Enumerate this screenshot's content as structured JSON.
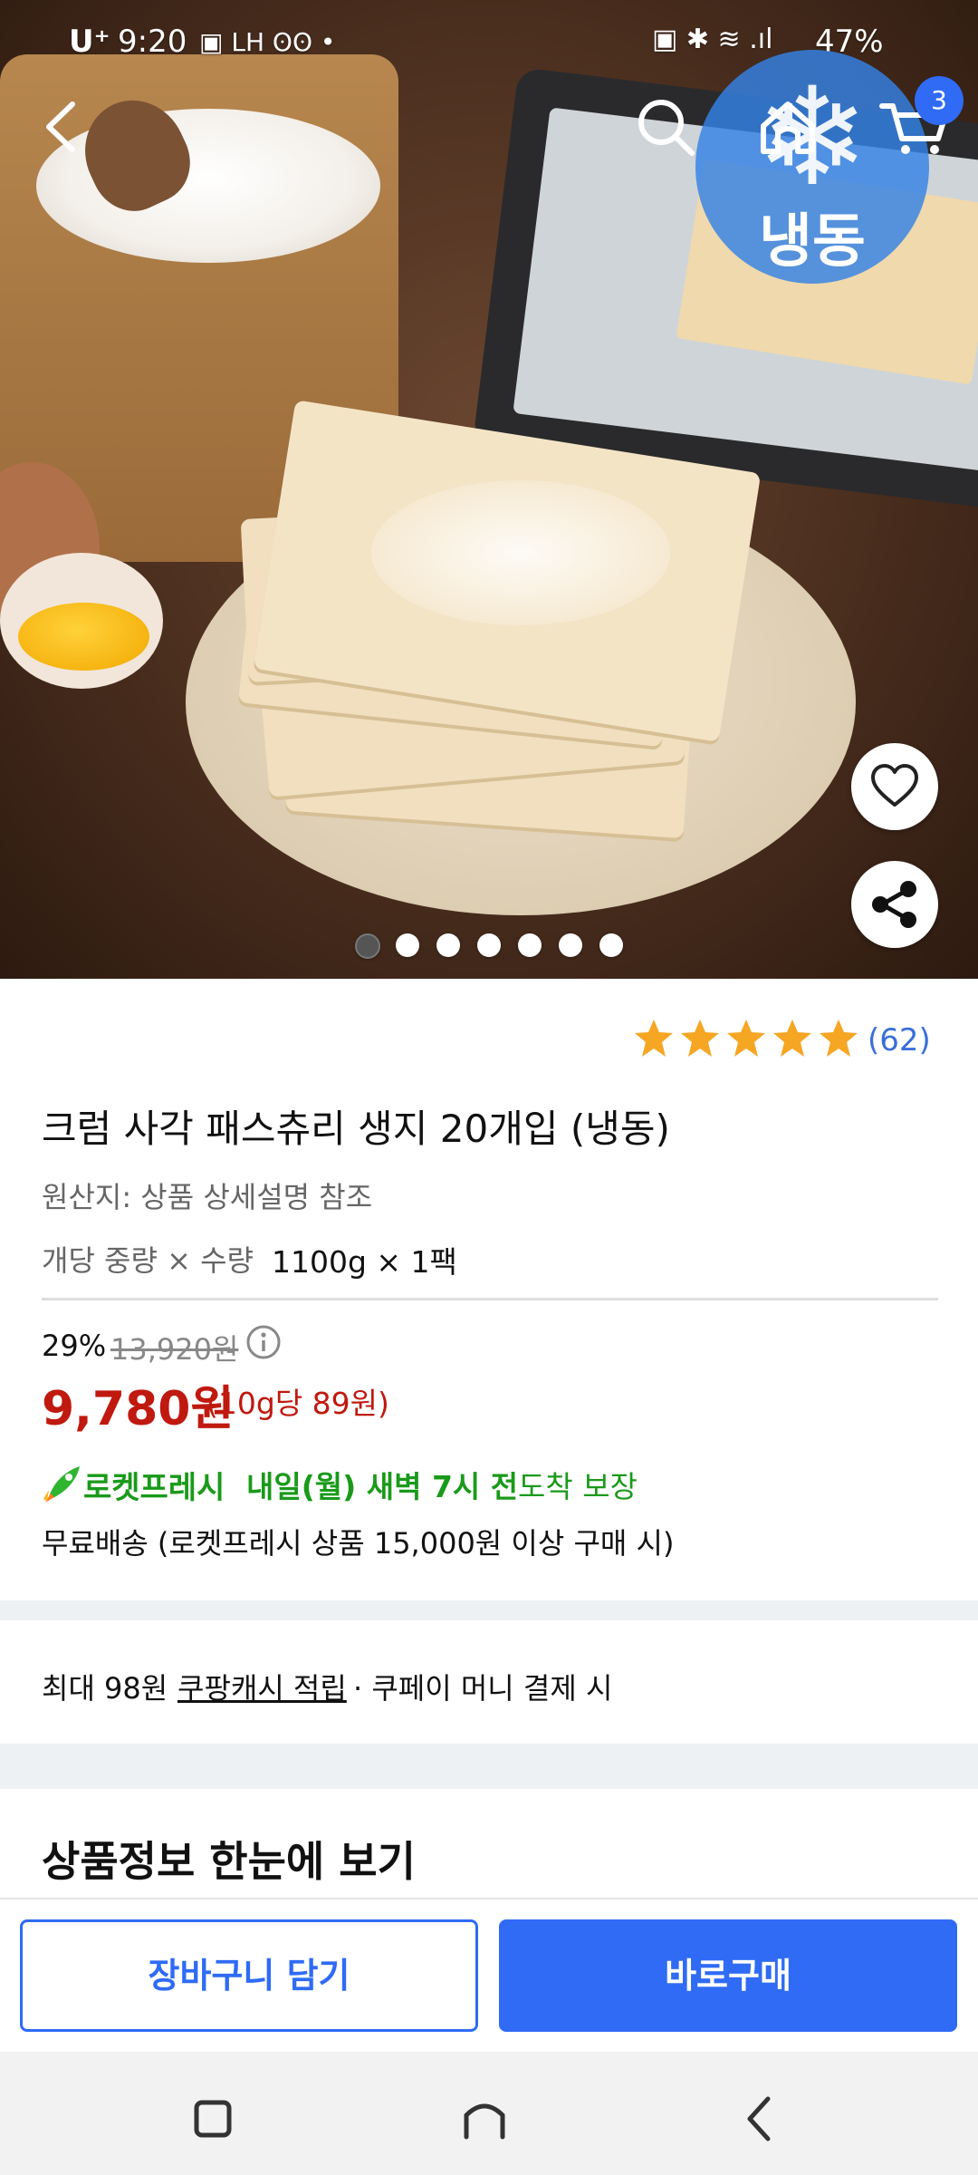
{
  "status_bar": {
    "carrier": "U⁺",
    "time": "9:20",
    "notification_icons": "▣ LH ʘʘ •",
    "system_icons": "▣ ✱ ≋ .ıl",
    "battery": "47%"
  },
  "nav": {
    "cart_count": "3",
    "frozen_label": "냉동",
    "frozen_icon": "snowflake-icon"
  },
  "gallery": {
    "image_count": 7,
    "active_index": 0
  },
  "product": {
    "rating": 5,
    "review_count": "(62)",
    "title": "크럼 사각 패스츄리 생지 20개입 (냉동)",
    "origin": "원산지: 상품 상세설명 참조",
    "spec_label": "개당 중량 × 수량",
    "spec_value": "1100g × 1팩",
    "discount": "29%",
    "original_price": "13,920원",
    "price": "9,780원",
    "unit_price": "(10g당 89원)"
  },
  "delivery": {
    "brand": "로켓프레시",
    "eta": "내일(월) 새벽 7시 전",
    "guarantee": "도착 보장",
    "shipping_note": "무료배송 (로켓프레시 상품 15,000원 이상 구매 시)"
  },
  "cashback": {
    "prefix": "최대 98원",
    "link": "쿠팡캐시 적립",
    "suffix": "· 쿠페이 머니 결제 시"
  },
  "section": {
    "title": "상품정보 한눈에 보기"
  },
  "actions": {
    "add_to_cart": "장바구니 담기",
    "buy_now": "바로구매"
  },
  "colors": {
    "accent_blue": "#2f6bf5",
    "price_red": "#c0190f",
    "rocket_green": "#1a9a1a",
    "star_gold": "#f5a623"
  }
}
